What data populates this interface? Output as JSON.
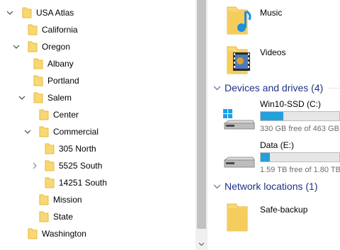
{
  "tree": {
    "items": [
      {
        "label": "USA Atlas",
        "chevron": "down"
      },
      {
        "label": "California",
        "chevron": "none"
      },
      {
        "label": "Oregon",
        "chevron": "down"
      },
      {
        "label": "Albany",
        "chevron": "none"
      },
      {
        "label": "Portland",
        "chevron": "none"
      },
      {
        "label": "Salem",
        "chevron": "down"
      },
      {
        "label": "Center",
        "chevron": "none"
      },
      {
        "label": "Commercial",
        "chevron": "down"
      },
      {
        "label": "305 North",
        "chevron": "none"
      },
      {
        "label": "5525 South",
        "chevron": "right"
      },
      {
        "label": "14251 South",
        "chevron": "none"
      },
      {
        "label": "Mission",
        "chevron": "none"
      },
      {
        "label": "State",
        "chevron": "none"
      },
      {
        "label": "Washington",
        "chevron": "none"
      }
    ]
  },
  "content": {
    "folders_top": [
      {
        "name": "Music",
        "icon": "music-folder-icon"
      },
      {
        "name": "Videos",
        "icon": "videos-folder-icon"
      }
    ],
    "devices_group": {
      "title": "Devices and drives (4)"
    },
    "drives": [
      {
        "name": "Win10-SSD (C:)",
        "free_text": "330 GB free of 463 GB",
        "used_fraction": 0.29,
        "icon": "windows-drive-icon"
      },
      {
        "name": "Data (E:)",
        "free_text": "1.59 TB free of 1.80 TB",
        "used_fraction": 0.12,
        "icon": "drive-icon"
      }
    ],
    "network_group": {
      "title": "Network locations (1)"
    },
    "network_items": [
      {
        "name": "Safe-backup",
        "icon": "network-folder-icon"
      }
    ]
  },
  "colors": {
    "folder": "#f8d775",
    "folder_dark": "#e8b936",
    "group_title": "#1e3287",
    "bar_fill": "#26a0da"
  }
}
